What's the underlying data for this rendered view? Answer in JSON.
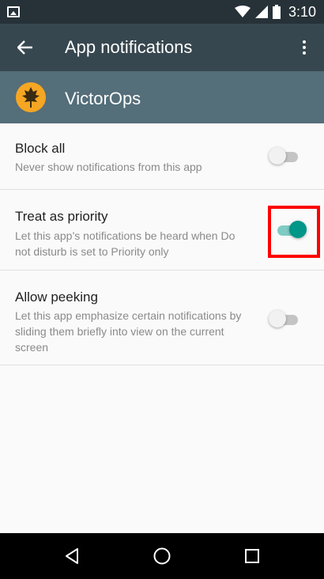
{
  "status_bar": {
    "time": "3:10",
    "icons": [
      "image-icon",
      "wifi-icon",
      "signal-icon",
      "battery-icon"
    ]
  },
  "app_bar": {
    "title": "App notifications",
    "back_icon": "arrow-back-icon",
    "more_icon": "more-vert-icon"
  },
  "app": {
    "name": "VictorOps",
    "logo_icon": "victorops-leaf-icon",
    "logo_color": "#f5a623"
  },
  "settings": [
    {
      "title": "Block all",
      "subtitle": "Never show notifications from this app",
      "enabled": false
    },
    {
      "title": "Treat as priority",
      "subtitle": "Let this app’s notifications be heard when Do not disturb is set to Priority only",
      "enabled": true
    },
    {
      "title": "Allow peeking",
      "subtitle": "Let this app emphasize certain notifications by sliding them briefly into view on the current screen",
      "enabled": false
    }
  ],
  "colors": {
    "status_bar": "#263238",
    "app_bar": "#37474f",
    "app_header": "#546e7a",
    "accent": "#009688",
    "highlight": "#ff0000"
  },
  "nav_bar": {
    "buttons": [
      "back-triangle-icon",
      "home-circle-icon",
      "recents-square-icon"
    ]
  }
}
